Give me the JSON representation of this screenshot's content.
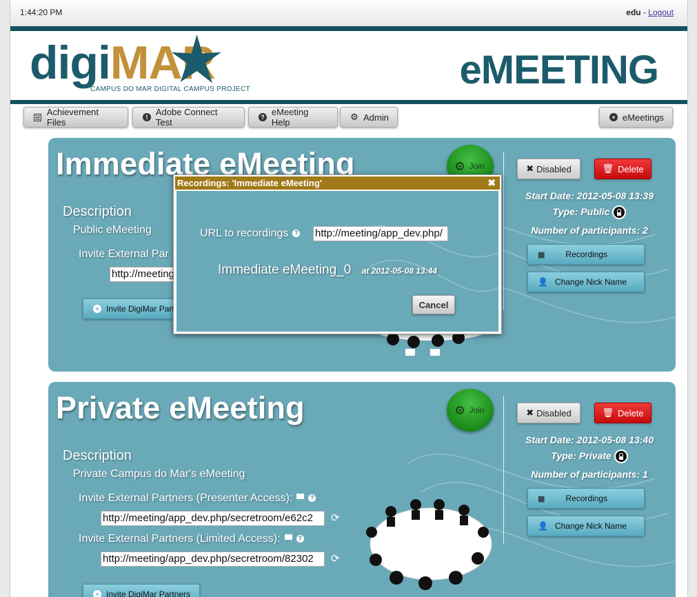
{
  "header": {
    "clock": "1:44:20 PM",
    "user": "edu",
    "separator": " - ",
    "logout": "Logout"
  },
  "banner": {
    "logo_part1": "digi",
    "logo_part2": "MAR",
    "logo_subtitle": "CAMPUS DO MAR DIGITAL CAMPUS PROJECT",
    "app_title": "eMEETING"
  },
  "nav": {
    "items": [
      {
        "label": "Achievement Files",
        "icon": "list-icon"
      },
      {
        "label": "Adobe Connect Test",
        "icon": "exclamation-icon"
      },
      {
        "label": "eMeeting Help",
        "icon": "question-icon"
      },
      {
        "label": "Admin",
        "icon": "gear-icon"
      }
    ],
    "right": {
      "label": "eMeetings",
      "icon": "plus-icon"
    }
  },
  "meetings": [
    {
      "title": "Immediate eMeeting",
      "join": "Join",
      "description_heading": "Description",
      "description": "Public eMeeting",
      "invite_label": "Invite External Par",
      "url_partial": "http://meeting",
      "invite_button": "Invite DigiMar Part",
      "disabled": "Disabled",
      "delete": "Delete",
      "start_date": "Start Date: 2012-05-08 13:39",
      "type": "Type: Public",
      "participants": "Number of participants: 2",
      "recordings": "Recordings",
      "change_nick": "Change Nick Name"
    },
    {
      "title": "Private eMeeting",
      "join": "Join",
      "description_heading": "Description",
      "description": "Private Campus do Mar's eMeeting",
      "invite_presenter_label": "Invite External Partners (Presenter Access):",
      "url_presenter": "http://meeting/app_dev.php/secretroom/e62c2",
      "invite_limited_label": "Invite External Partners (Limited Access):",
      "url_limited": "http://meeting/app_dev.php/secretroom/82302",
      "invite_button": "Invite DigiMar Partners",
      "disabled": "Disabled",
      "delete": "Delete",
      "start_date": "Start Date: 2012-05-08 13:40",
      "type": "Type: Private",
      "participants": "Number of participants: 1",
      "recordings": "Recordings",
      "change_nick": "Change Nick Name"
    }
  ],
  "modal": {
    "title": "Recordings: 'Immediate eMeeting'",
    "url_label": "URL to recordings",
    "url_value": "http://meeting/app_dev.php/",
    "recording_name": "Immediate eMeeting_0",
    "recording_time": "at 2012-05-08 13:44",
    "cancel": "Cancel"
  },
  "colors": {
    "dark_teal": "#15525f",
    "panel_teal": "#6aa9b8",
    "logo_gold": "#c3913a",
    "modal_header": "#a07a18",
    "delete_red": "#d91c1c",
    "join_green": "#2aa52a"
  }
}
